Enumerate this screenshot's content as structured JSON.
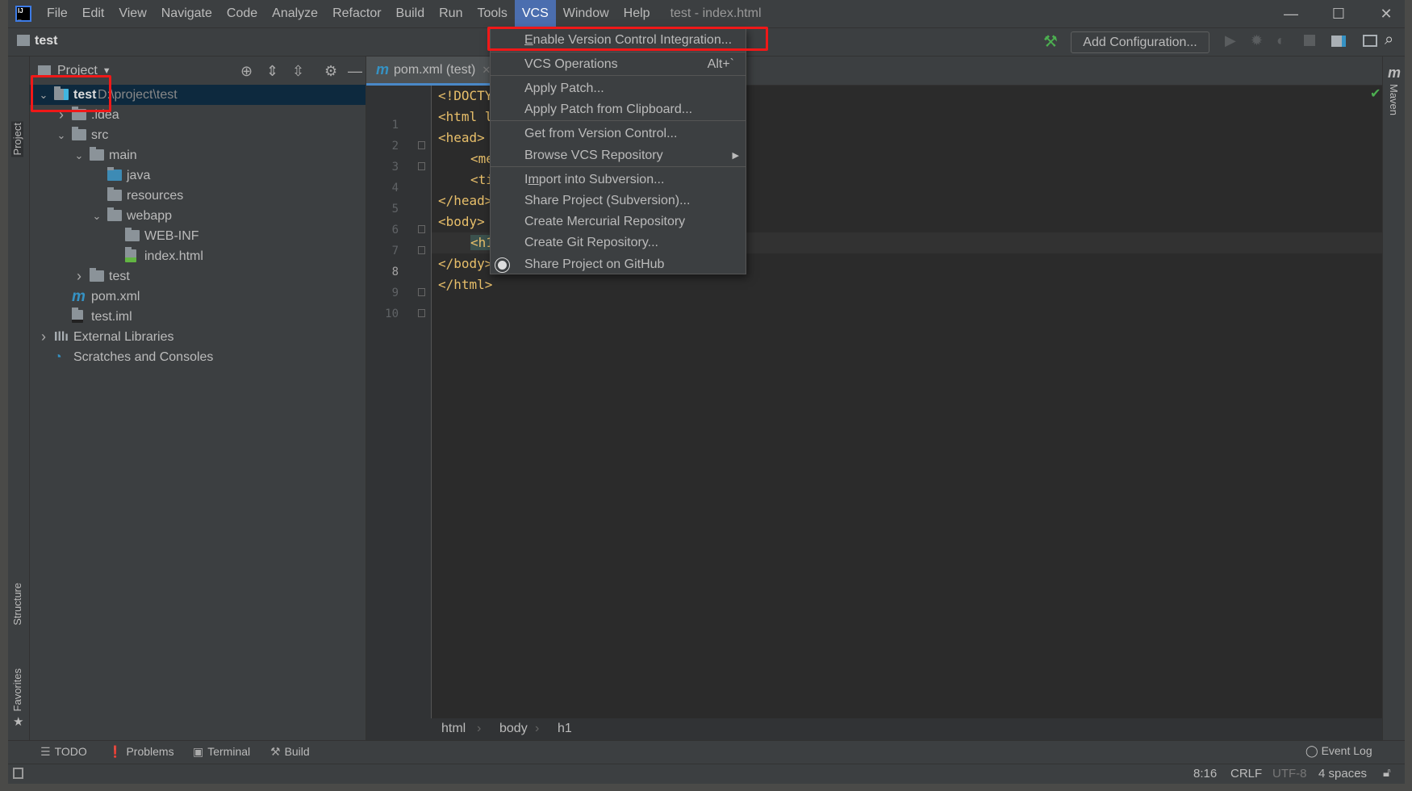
{
  "menubar": {
    "items": [
      "File",
      "Edit",
      "View",
      "Navigate",
      "Code",
      "Analyze",
      "Refactor",
      "Build",
      "Run",
      "Tools",
      "VCS",
      "Window",
      "Help"
    ],
    "active": "VCS",
    "window_title": "test - index.html"
  },
  "navbar": {
    "project": "test",
    "add_config": "Add Configuration..."
  },
  "left_stripe": {
    "project": "Project",
    "structure": "Structure",
    "favorites": "Favorites"
  },
  "right_stripe": {
    "maven": "Maven"
  },
  "project_panel": {
    "title": "Project",
    "tree": [
      {
        "label": "test",
        "path": "D:\\project\\test",
        "depth": 0,
        "expanded": true,
        "selected": true,
        "icon": "module-folder-icon"
      },
      {
        "label": ".idea",
        "depth": 1,
        "expanded": false,
        "icon": "folder-icon"
      },
      {
        "label": "src",
        "depth": 1,
        "expanded": true,
        "icon": "folder-icon"
      },
      {
        "label": "main",
        "depth": 2,
        "expanded": true,
        "icon": "folder-icon"
      },
      {
        "label": "java",
        "depth": 3,
        "icon": "source-folder-icon"
      },
      {
        "label": "resources",
        "depth": 3,
        "icon": "resources-folder-icon"
      },
      {
        "label": "webapp",
        "depth": 3,
        "expanded": true,
        "icon": "folder-icon"
      },
      {
        "label": "WEB-INF",
        "depth": 4,
        "icon": "folder-icon"
      },
      {
        "label": "index.html",
        "depth": 4,
        "icon": "html-file-icon"
      },
      {
        "label": "test",
        "depth": 2,
        "expanded": false,
        "icon": "folder-icon"
      },
      {
        "label": "pom.xml",
        "depth": 1,
        "icon": "maven-file-icon"
      },
      {
        "label": "test.iml",
        "depth": 1,
        "icon": "iml-file-icon"
      },
      {
        "label": "External Libraries",
        "depth": 0,
        "expanded": false,
        "icon": "libraries-icon"
      },
      {
        "label": "Scratches and Consoles",
        "depth": 0,
        "icon": "scratches-icon"
      }
    ]
  },
  "editor": {
    "tab": "pom.xml (test)",
    "current_line": 8,
    "lines": [
      {
        "n": "1",
        "indent": 0,
        "text": "<!DOCTYPE"
      },
      {
        "n": "2",
        "indent": 0,
        "text": "<html lar"
      },
      {
        "n": "3",
        "indent": 0,
        "text": "<head>"
      },
      {
        "n": "4",
        "indent": 1,
        "text": "<meta"
      },
      {
        "n": "5",
        "indent": 1,
        "text": "<titl"
      },
      {
        "n": "6",
        "indent": 0,
        "text": "</head>"
      },
      {
        "n": "7",
        "indent": 0,
        "text": "<body>"
      },
      {
        "n": "8",
        "indent": 1,
        "text": "<h1>t"
      },
      {
        "n": "9",
        "indent": 0,
        "text": "</body>"
      },
      {
        "n": "10",
        "indent": 0,
        "text": "</html>"
      }
    ],
    "breadcrumbs": [
      "html",
      "body",
      "h1"
    ]
  },
  "vcs_menu": {
    "items": [
      {
        "label": "Enable Version Control Integration...",
        "mnemonic": "E",
        "highlighted": true
      },
      {
        "label": "VCS Operations",
        "shortcut": "Alt+`"
      },
      {
        "label": "Apply Patch..."
      },
      {
        "label": "Apply Patch from Clipboard..."
      },
      {
        "label": "Get from Version Control..."
      },
      {
        "label": "Browse VCS Repository",
        "submenu": true
      },
      {
        "label": "Import into Subversion...",
        "mnemonic": "m"
      },
      {
        "label": "Share Project (Subversion)..."
      },
      {
        "label": "Create Mercurial Repository"
      },
      {
        "label": "Create Git Repository..."
      },
      {
        "label": "Share Project on GitHub",
        "icon": "github-icon"
      }
    ]
  },
  "bottom_tools": [
    "TODO",
    "Problems",
    "Terminal",
    "Build"
  ],
  "event_log": "Event Log",
  "status": {
    "position": "8:16",
    "line_sep": "CRLF",
    "encoding": "UTF-8",
    "indent": "4 spaces"
  },
  "colors": {
    "accent": "#4b6eaf",
    "highlight_box": "#f01818",
    "selection": "#0d293e"
  }
}
